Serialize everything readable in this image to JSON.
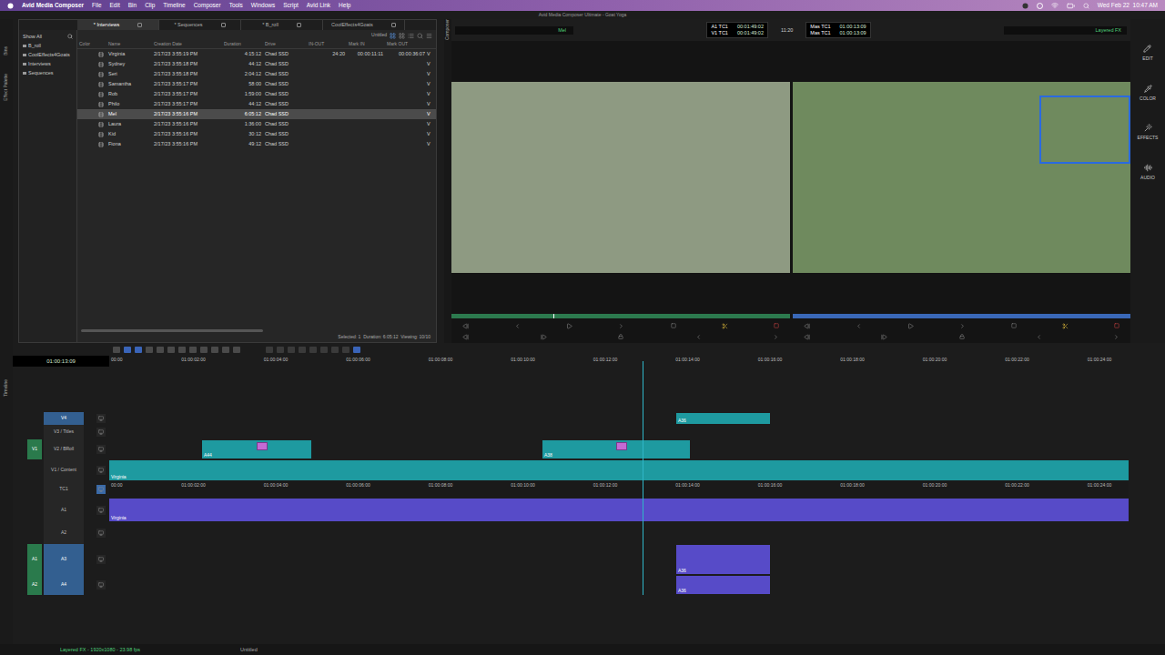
{
  "menubar": {
    "app": "Avid Media Composer",
    "items": [
      "File",
      "Edit",
      "Bin",
      "Clip",
      "Timeline",
      "Composer",
      "Tools",
      "Windows",
      "Script",
      "Avid Link",
      "Help"
    ],
    "clock": "Wed Feb 22  10:47 AM"
  },
  "window": {
    "title": "Avid Media Composer Ultimate - Goat Yoga"
  },
  "sideTabs": [
    "Bins",
    "Effect Palette"
  ],
  "bin": {
    "filter": "Show All",
    "tree": [
      {
        "label": "B_roll",
        "selected": false
      },
      {
        "label": "CoolEffects4Goats",
        "selected": false
      },
      {
        "label": "Interviews",
        "selected": false
      },
      {
        "label": "Sequences",
        "selected": false
      }
    ],
    "tabs": [
      {
        "label": "* Interviews",
        "selected": true
      },
      {
        "label": "* Sequences",
        "selected": false
      },
      {
        "label": "* B_roll",
        "selected": false
      },
      {
        "label": "CoolEffects4Goats",
        "selected": false
      }
    ],
    "view": "Untitled",
    "columns": [
      "Color",
      "Name",
      "Creation Date",
      "Duration",
      "Drive",
      "IN-OUT",
      "Mark IN",
      "Mark OUT"
    ],
    "rows": [
      {
        "name": "Virginia",
        "created": "2/17/23 3:55:19 PM",
        "duration": "4:15:12",
        "drive": "Chad SSD",
        "inout": "24:20",
        "markIn": "00:00:11:11",
        "markOut": "00:00:36:07",
        "tracks": "V",
        "selected": false
      },
      {
        "name": "Sydney",
        "created": "2/17/23 3:55:18 PM",
        "duration": "44:12",
        "drive": "Chad SSD",
        "inout": "",
        "markIn": "",
        "markOut": "",
        "tracks": "V",
        "selected": false
      },
      {
        "name": "Seri",
        "created": "2/17/23 3:55:18 PM",
        "duration": "2:04:12",
        "drive": "Chad SSD",
        "inout": "",
        "markIn": "",
        "markOut": "",
        "tracks": "V",
        "selected": false
      },
      {
        "name": "Samantha",
        "created": "2/17/23 3:55:17 PM",
        "duration": "58:00",
        "drive": "Chad SSD",
        "inout": "",
        "markIn": "",
        "markOut": "",
        "tracks": "V",
        "selected": false
      },
      {
        "name": "Rob",
        "created": "2/17/23 3:55:17 PM",
        "duration": "1:59:00",
        "drive": "Chad SSD",
        "inout": "",
        "markIn": "",
        "markOut": "",
        "tracks": "V",
        "selected": false
      },
      {
        "name": "Philo",
        "created": "2/17/23 3:55:17 PM",
        "duration": "44:12",
        "drive": "Chad SSD",
        "inout": "",
        "markIn": "",
        "markOut": "",
        "tracks": "V",
        "selected": false
      },
      {
        "name": "Mel",
        "created": "2/17/23 3:55:16 PM",
        "duration": "6:05:12",
        "drive": "Chad SSD",
        "inout": "",
        "markIn": "",
        "markOut": "",
        "tracks": "V",
        "selected": true
      },
      {
        "name": "Laura",
        "created": "2/17/23 3:55:16 PM",
        "duration": "1:36:00",
        "drive": "Chad SSD",
        "inout": "",
        "markIn": "",
        "markOut": "",
        "tracks": "V",
        "selected": false
      },
      {
        "name": "Kid",
        "created": "2/17/23 3:55:16 PM",
        "duration": "30:12",
        "drive": "Chad SSD",
        "inout": "",
        "markIn": "",
        "markOut": "",
        "tracks": "V",
        "selected": false
      },
      {
        "name": "Fiona",
        "created": "2/17/23 3:55:16 PM",
        "duration": "49:12",
        "drive": "Chad SSD",
        "inout": "",
        "markIn": "",
        "markOut": "",
        "tracks": "V",
        "selected": false
      }
    ],
    "status": "Selected: 1  Duration: 6:05:12  Viewing: 10/10"
  },
  "composer": {
    "tab": "Composer",
    "source": "Mel",
    "sourceTc": [
      {
        "label": "A1 TC1",
        "value": "00:01:49:02"
      },
      {
        "label": "V1 TC1",
        "value": "00:01:49:02"
      }
    ],
    "center": "11:20",
    "recordTc": [
      {
        "label": "Mas TC1",
        "value": "01:00:13:09"
      },
      {
        "label": "Mas TC1",
        "value": "01:00:13:09"
      }
    ],
    "record": "Layered FX",
    "sourcePosition": 0.3
  },
  "workspaces": [
    "EDIT",
    "COLOR",
    "EFFECTS",
    "AUDIO"
  ],
  "timeline": {
    "tab": "Timeline",
    "timecode": "01:00:13:09",
    "ruler": [
      "00:00",
      "01:00:02:00",
      "01:00:04:00",
      "01:00:06:00",
      "01:00:08:00",
      "01:00:10:00",
      "01:00:12:00",
      "01:00:14:00",
      "01:00:16:00",
      "01:00:18:00",
      "01:00:20:00",
      "01:00:22:00",
      "01:00:24:00"
    ],
    "playhead": 0.523,
    "tracks": [
      {
        "label": "V4",
        "patch": "",
        "selected": true,
        "kind": "video"
      },
      {
        "label": "V3 / Titles",
        "patch": "",
        "selected": false,
        "kind": "video"
      },
      {
        "label": "V2 / BRoll",
        "patch": "V1",
        "selected": false,
        "kind": "video"
      },
      {
        "label": "V1 / Content",
        "patch": "",
        "selected": false,
        "kind": "video"
      },
      {
        "label": "TC1",
        "patch": "",
        "selected": false,
        "kind": "tc"
      },
      {
        "label": "A1",
        "patch": "",
        "selected": false,
        "kind": "audio"
      },
      {
        "label": "A2",
        "patch": "",
        "selected": false,
        "kind": "audio"
      },
      {
        "label": "A3",
        "patch": "A1",
        "selected": true,
        "kind": "audio"
      },
      {
        "label": "A4",
        "patch": "A2",
        "selected": true,
        "kind": "audio"
      }
    ],
    "clips": [
      {
        "track": 0,
        "label": "A36",
        "kind": "video",
        "effect": false
      },
      {
        "track": 2,
        "label": "A44",
        "kind": "video",
        "effect": true
      },
      {
        "track": 2,
        "label": "A38",
        "kind": "video",
        "effect": true
      },
      {
        "track": 3,
        "label": "Virginia",
        "kind": "video",
        "effect": false
      },
      {
        "track": 5,
        "label": "Virginia",
        "kind": "audio",
        "effect": false
      },
      {
        "track": 7,
        "label": "A36",
        "kind": "audio",
        "effect": false
      },
      {
        "track": 8,
        "label": "A36",
        "kind": "audio",
        "effect": false
      }
    ]
  },
  "statusbar": {
    "format": "Layered FX - 1920x1080 - 23.98 fps",
    "sequence": "Untitled"
  }
}
